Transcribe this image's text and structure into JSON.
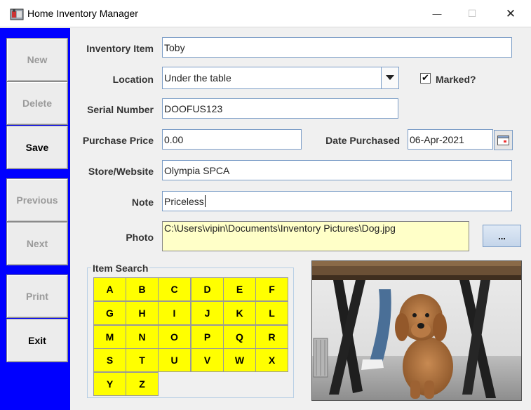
{
  "window": {
    "title": "Home Inventory Manager",
    "minimize_glyph": "—",
    "maximize_glyph": "☐",
    "close_glyph": "✕"
  },
  "toolbar": {
    "new_label": "New",
    "delete_label": "Delete",
    "save_label": "Save",
    "previous_label": "Previous",
    "next_label": "Next",
    "print_label": "Print",
    "exit_label": "Exit"
  },
  "form": {
    "inventory_item_label": "Inventory Item",
    "inventory_item_value": "Toby",
    "location_label": "Location",
    "location_value": "Under the table",
    "marked_label": "Marked?",
    "marked_checked": true,
    "marked_glyph": "✔",
    "serial_label": "Serial Number",
    "serial_value": "DOOFUS123",
    "price_label": "Purchase Price",
    "price_value": "0.00",
    "date_label": "Date Purchased",
    "date_value": "06-Apr-2021",
    "store_label": "Store/Website",
    "store_value": "Olympia SPCA",
    "note_label": "Note",
    "note_value": "Priceless",
    "photo_label": "Photo",
    "photo_path": "C:\\Users\\vipin\\Documents\\Inventory Pictures\\Dog.jpg",
    "browse_label": "..."
  },
  "search": {
    "title": "Item Search",
    "letters": [
      "A",
      "B",
      "C",
      "D",
      "E",
      "F",
      "G",
      "H",
      "I",
      "J",
      "K",
      "L",
      "M",
      "N",
      "O",
      "P",
      "Q",
      "R",
      "S",
      "T",
      "U",
      "V",
      "W",
      "X",
      "Y",
      "Z"
    ]
  },
  "colors": {
    "toolbar_bg": "#0000ff",
    "letter_bg": "#ffff00",
    "photo_field_bg": "#ffffc8"
  }
}
